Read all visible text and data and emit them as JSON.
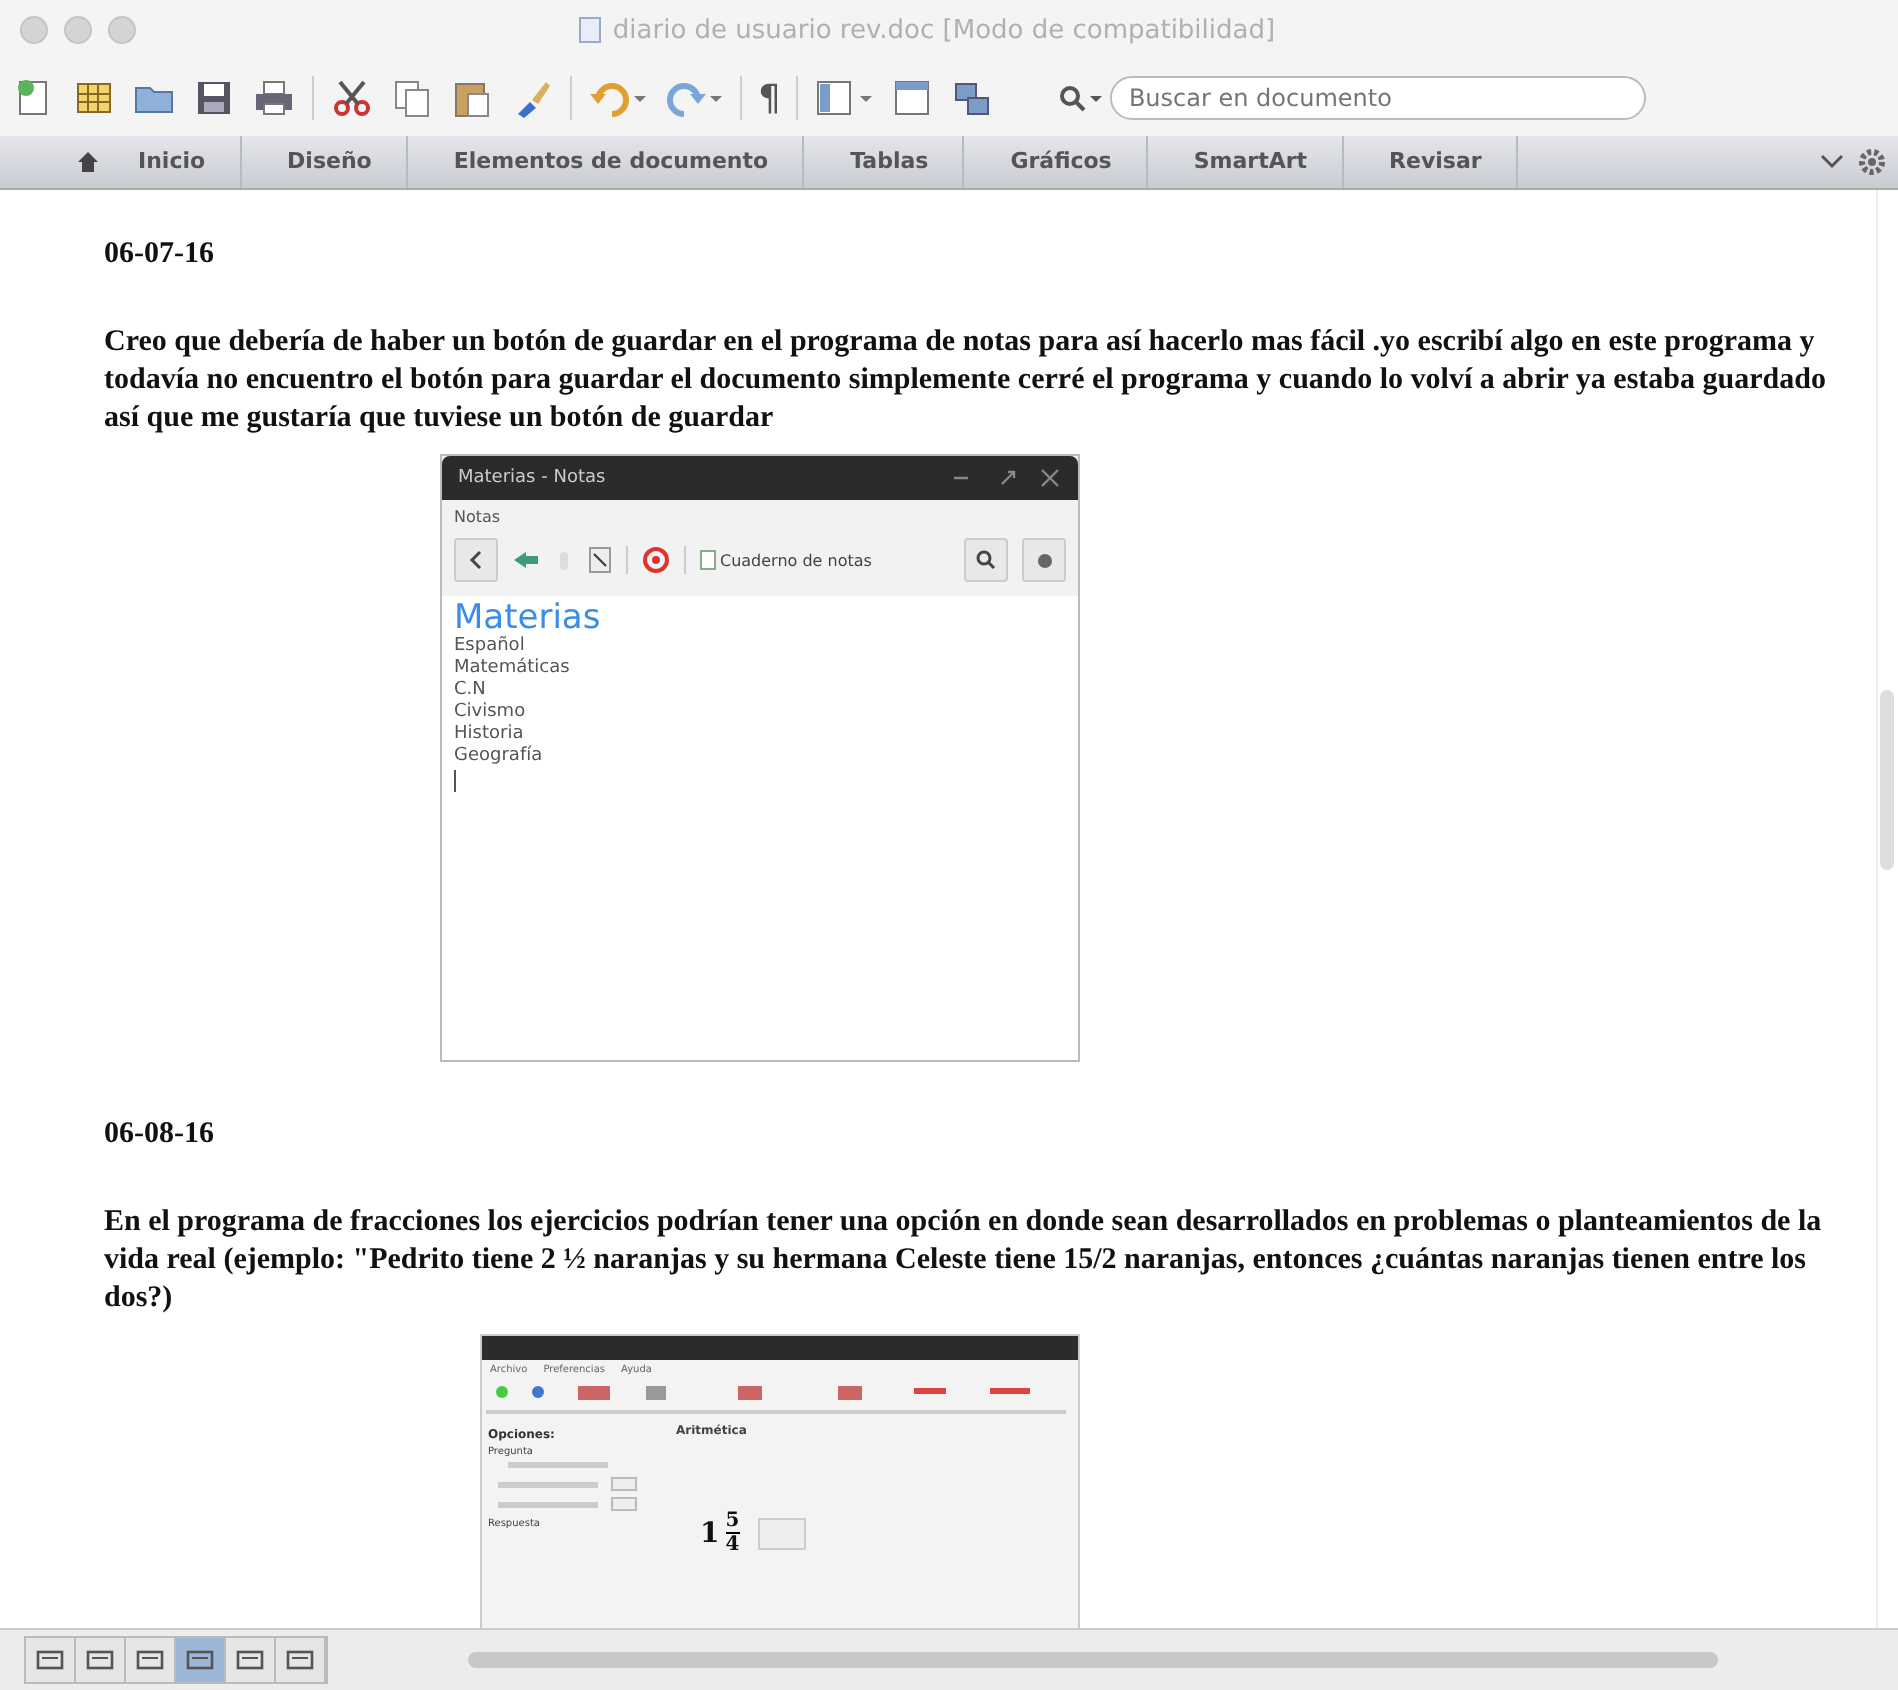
{
  "window": {
    "title": "diario de usuario rev.doc [Modo de compatibilidad]"
  },
  "toolbar": {
    "pilcrow": "¶"
  },
  "search": {
    "placeholder": "Buscar en documento"
  },
  "ribbon_tabs": [
    {
      "label": "Inicio"
    },
    {
      "label": "Diseño"
    },
    {
      "label": "Elementos de documento"
    },
    {
      "label": "Tablas"
    },
    {
      "label": "Gráficos"
    },
    {
      "label": "SmartArt"
    },
    {
      "label": "Revisar"
    }
  ],
  "entries": [
    {
      "date": "06-07-16",
      "text": "Creo que debería de haber un botón de guardar en el programa de notas para así hacerlo mas fácil .yo escribí algo en este programa y todavía no encuentro el botón para guardar el documento simplemente cerré el programa y cuando lo volví a abrir ya estaba guardado así que me gustaría que tuviese un botón de guardar",
      "screenshot": {
        "kind": "notes",
        "title": "Materias - Notas",
        "menu": "Notas",
        "notebook": "Cuaderno de notas",
        "heading": "Materias",
        "lines": [
          "Español",
          "Matemáticas",
          "C.N",
          "Civismo",
          "Historia",
          "Geografía"
        ]
      }
    },
    {
      "date": "06-08-16",
      "text": "En el programa de fracciones los ejercicios podrían tener una opción en donde sean desarrollados en problemas o planteamientos de la vida real (ejemplo: \"Pedrito tiene 2 ½ naranjas y su hermana Celeste tiene 15/2 naranjas, entonces ¿cuántas naranjas tienen entre los dos?)",
      "screenshot": {
        "kind": "fractions",
        "menus": [
          "Archivo",
          "Preferencias",
          "Ayuda"
        ],
        "section": "Aritmética",
        "options_title": "Opciones:",
        "groups": [
          "Pregunta",
          "Respuesta"
        ],
        "whole": "1",
        "numerator": "5",
        "denominator": "4"
      }
    }
  ],
  "view_buttons": [
    {
      "selected": false
    },
    {
      "selected": false
    },
    {
      "selected": false
    },
    {
      "selected": true
    },
    {
      "selected": false
    },
    {
      "selected": false
    }
  ]
}
